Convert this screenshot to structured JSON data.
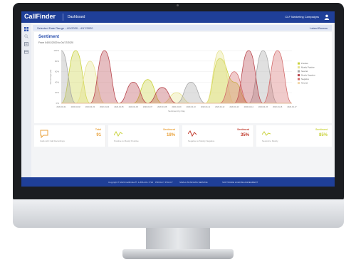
{
  "app": {
    "logo": "CallFinder",
    "page": "Dashboard",
    "campaign": "CLF Marketing Campaigns"
  },
  "date_range": {
    "label": "Selected Date Range - 4/1/2020 - 4/17/2020",
    "action": "Latest Bureau"
  },
  "sentiment": {
    "title": "Sentiment",
    "subtitle": "From 04/01/2020 to 04/17/2020"
  },
  "metrics": [
    {
      "label": "Calls with Call Recordings",
      "caption": "Total",
      "value": "91",
      "color": "#e9a23b",
      "icon": "chat-bubble-icon"
    },
    {
      "label": "Positive to Mostly Positive",
      "caption": "Sentiment",
      "value": "18%",
      "color": "#e9a23b",
      "icon": "trend-line-icon"
    },
    {
      "label": "Negative to Mostly Negative",
      "caption": "Sentiment",
      "value": "35%",
      "color": "#c0392b",
      "icon": "trend-line-icon"
    },
    {
      "label": "Neutral to Mostly",
      "caption": "Sentiment",
      "value": "85%",
      "color": "#c9d23b",
      "icon": "trend-line-icon"
    }
  ],
  "footer": {
    "copyright": "Copyright © 2020 CallFinder®. 1-866-401-7723",
    "links": [
      "PRIVACY POLICY",
      "SMALL BUSINESS SERVICE",
      "SOFTWARE LICENSE AGREEMENT"
    ]
  },
  "chart_data": {
    "type": "area",
    "xlabel": "Sentiment by Day",
    "ylabel": "Percentage (%)",
    "ylim": [
      0,
      100
    ],
    "y_ticks": [
      "100%",
      "80%",
      "60%",
      "40%",
      "20%",
      "0%"
    ],
    "categories": [
      "2020-04-01",
      "2020-04-02",
      "2020-04-03",
      "2020-04-04",
      "2020-04-05",
      "2020-04-06",
      "2020-04-07",
      "2020-04-08",
      "2020-04-09",
      "2020-04-10",
      "2020-04-11",
      "2020-04-12",
      "2020-04-13",
      "2020-04-14",
      "2020-04-15",
      "2020-04-16",
      "2020-04-17"
    ],
    "series": [
      {
        "name": "Positive",
        "color": "#c9d23b",
        "values": [
          0,
          100,
          0,
          0,
          0,
          0,
          45,
          0,
          0,
          0,
          0,
          85,
          40,
          0,
          0,
          0,
          0
        ]
      },
      {
        "name": "Mostly Positive",
        "color": "#e6e18c",
        "values": [
          0,
          0,
          80,
          0,
          0,
          0,
          0,
          0,
          20,
          0,
          0,
          100,
          0,
          0,
          0,
          0,
          0
        ]
      },
      {
        "name": "Neutral",
        "color": "#a7a7a7",
        "values": [
          100,
          0,
          0,
          0,
          0,
          0,
          0,
          0,
          0,
          40,
          0,
          0,
          0,
          0,
          100,
          0,
          0
        ]
      },
      {
        "name": "Mostly Negative",
        "color": "#b8454c",
        "values": [
          0,
          0,
          0,
          100,
          0,
          40,
          0,
          30,
          0,
          0,
          0,
          0,
          0,
          100,
          0,
          0,
          0
        ]
      },
      {
        "name": "Negative",
        "color": "#d36b6b",
        "values": [
          0,
          0,
          0,
          0,
          0,
          0,
          0,
          0,
          0,
          0,
          0,
          0,
          60,
          0,
          0,
          100,
          0
        ]
      },
      {
        "name": "Neutral",
        "color": "#f1d7a8",
        "values": [
          0,
          0,
          0,
          0,
          0,
          0,
          0,
          0,
          0,
          0,
          0,
          0,
          0,
          0,
          0,
          0,
          0
        ]
      }
    ],
    "legend": "right"
  }
}
